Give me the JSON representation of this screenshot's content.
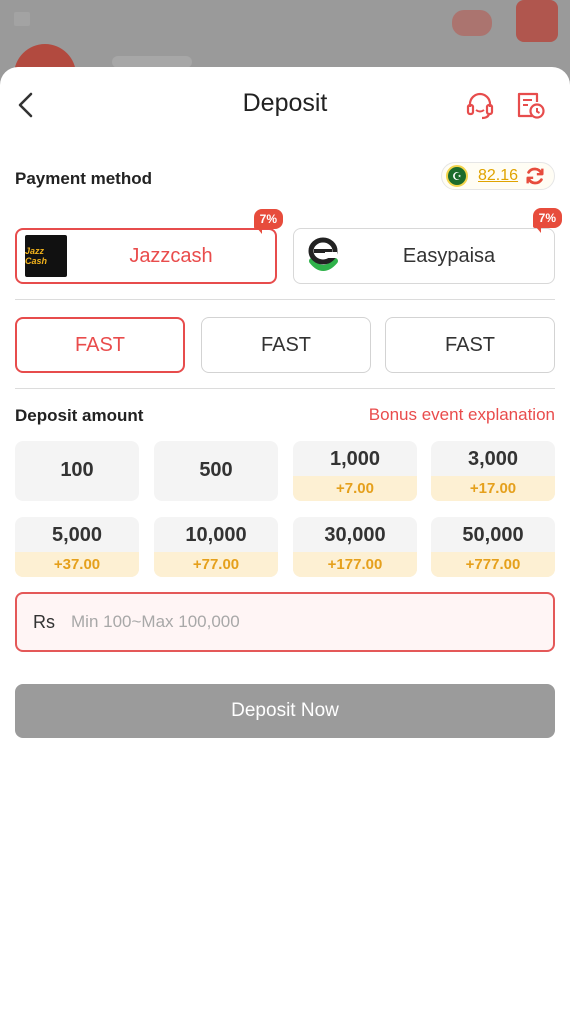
{
  "header": {
    "title": "Deposit"
  },
  "payment": {
    "label": "Payment method",
    "balance": "82.16",
    "flag_glyph": "☪"
  },
  "channels": [
    {
      "label": "Jazzcash",
      "logo_text": "Jazz Cash",
      "badge": "7%",
      "selected": true
    },
    {
      "label": "Easypaisa",
      "badge": "7%",
      "selected": false
    }
  ],
  "fast_options": [
    {
      "label": "FAST",
      "selected": true
    },
    {
      "label": "FAST",
      "selected": false
    },
    {
      "label": "FAST",
      "selected": false
    }
  ],
  "deposit_amount": {
    "label": "Deposit amount",
    "bonus_link": "Bonus event explanation"
  },
  "amounts": [
    {
      "value": "100",
      "bonus": ""
    },
    {
      "value": "500",
      "bonus": ""
    },
    {
      "value": "1,000",
      "bonus": "+7.00"
    },
    {
      "value": "3,000",
      "bonus": "+17.00"
    },
    {
      "value": "5,000",
      "bonus": "+37.00"
    },
    {
      "value": "10,000",
      "bonus": "+77.00"
    },
    {
      "value": "30,000",
      "bonus": "+177.00"
    },
    {
      "value": "50,000",
      "bonus": "+777.00"
    }
  ],
  "input": {
    "currency": "Rs",
    "placeholder": "Min 100~Max 100,000",
    "value": ""
  },
  "submit": {
    "label": "Deposit Now"
  },
  "colors": {
    "accent": "#e94c4c",
    "bonus_text": "#e5a01c",
    "bonus_bg": "#fdf0d3",
    "button_disabled": "#9b9b9b"
  }
}
